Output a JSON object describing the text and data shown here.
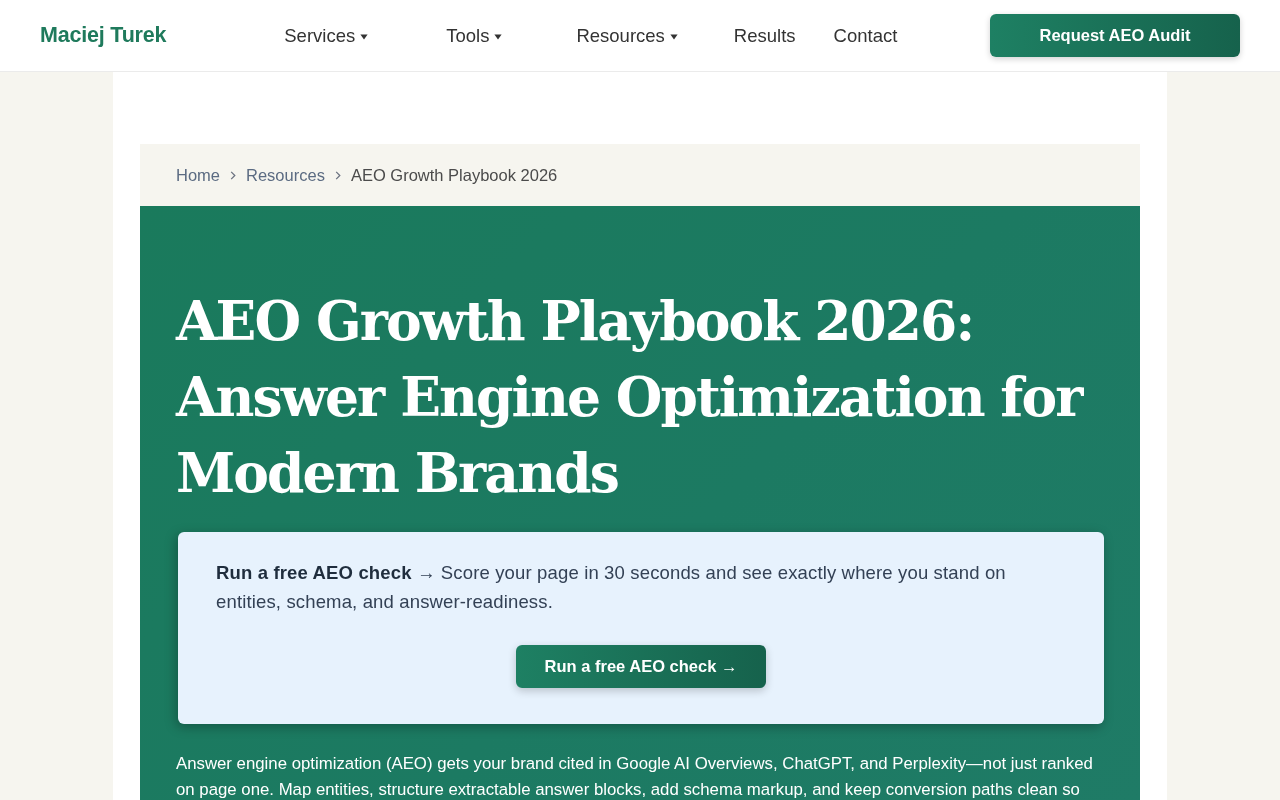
{
  "header": {
    "logo": "Maciej Turek",
    "nav": [
      {
        "label": "Services",
        "dropdown": true
      },
      {
        "label": "Tools",
        "dropdown": true
      },
      {
        "label": "Resources",
        "dropdown": true
      },
      {
        "label": "Results",
        "dropdown": false
      },
      {
        "label": "Contact",
        "dropdown": false
      }
    ],
    "cta": "Request AEO Audit"
  },
  "breadcrumb": [
    {
      "label": "Home",
      "current": false
    },
    {
      "label": "Resources",
      "current": false
    },
    {
      "label": "AEO Growth Playbook 2026",
      "current": true
    }
  ],
  "hero": {
    "title": "AEO Growth Playbook 2026: Answer Engine Optimization for Modern Brands",
    "callout": {
      "text": "**Run a free AEO check** → Score your page in 30 seconds and see exactly where you stand on entities, schema, and answer-readiness.",
      "button": "Run a free AEO check →"
    },
    "intro": "Answer engine optimization (AEO) gets your brand cited in Google AI Overviews, ChatGPT, and Perplexity—not just ranked on page one. Map entities, structure extractable answer blocks, add schema markup, and keep conversion paths clean so"
  }
}
